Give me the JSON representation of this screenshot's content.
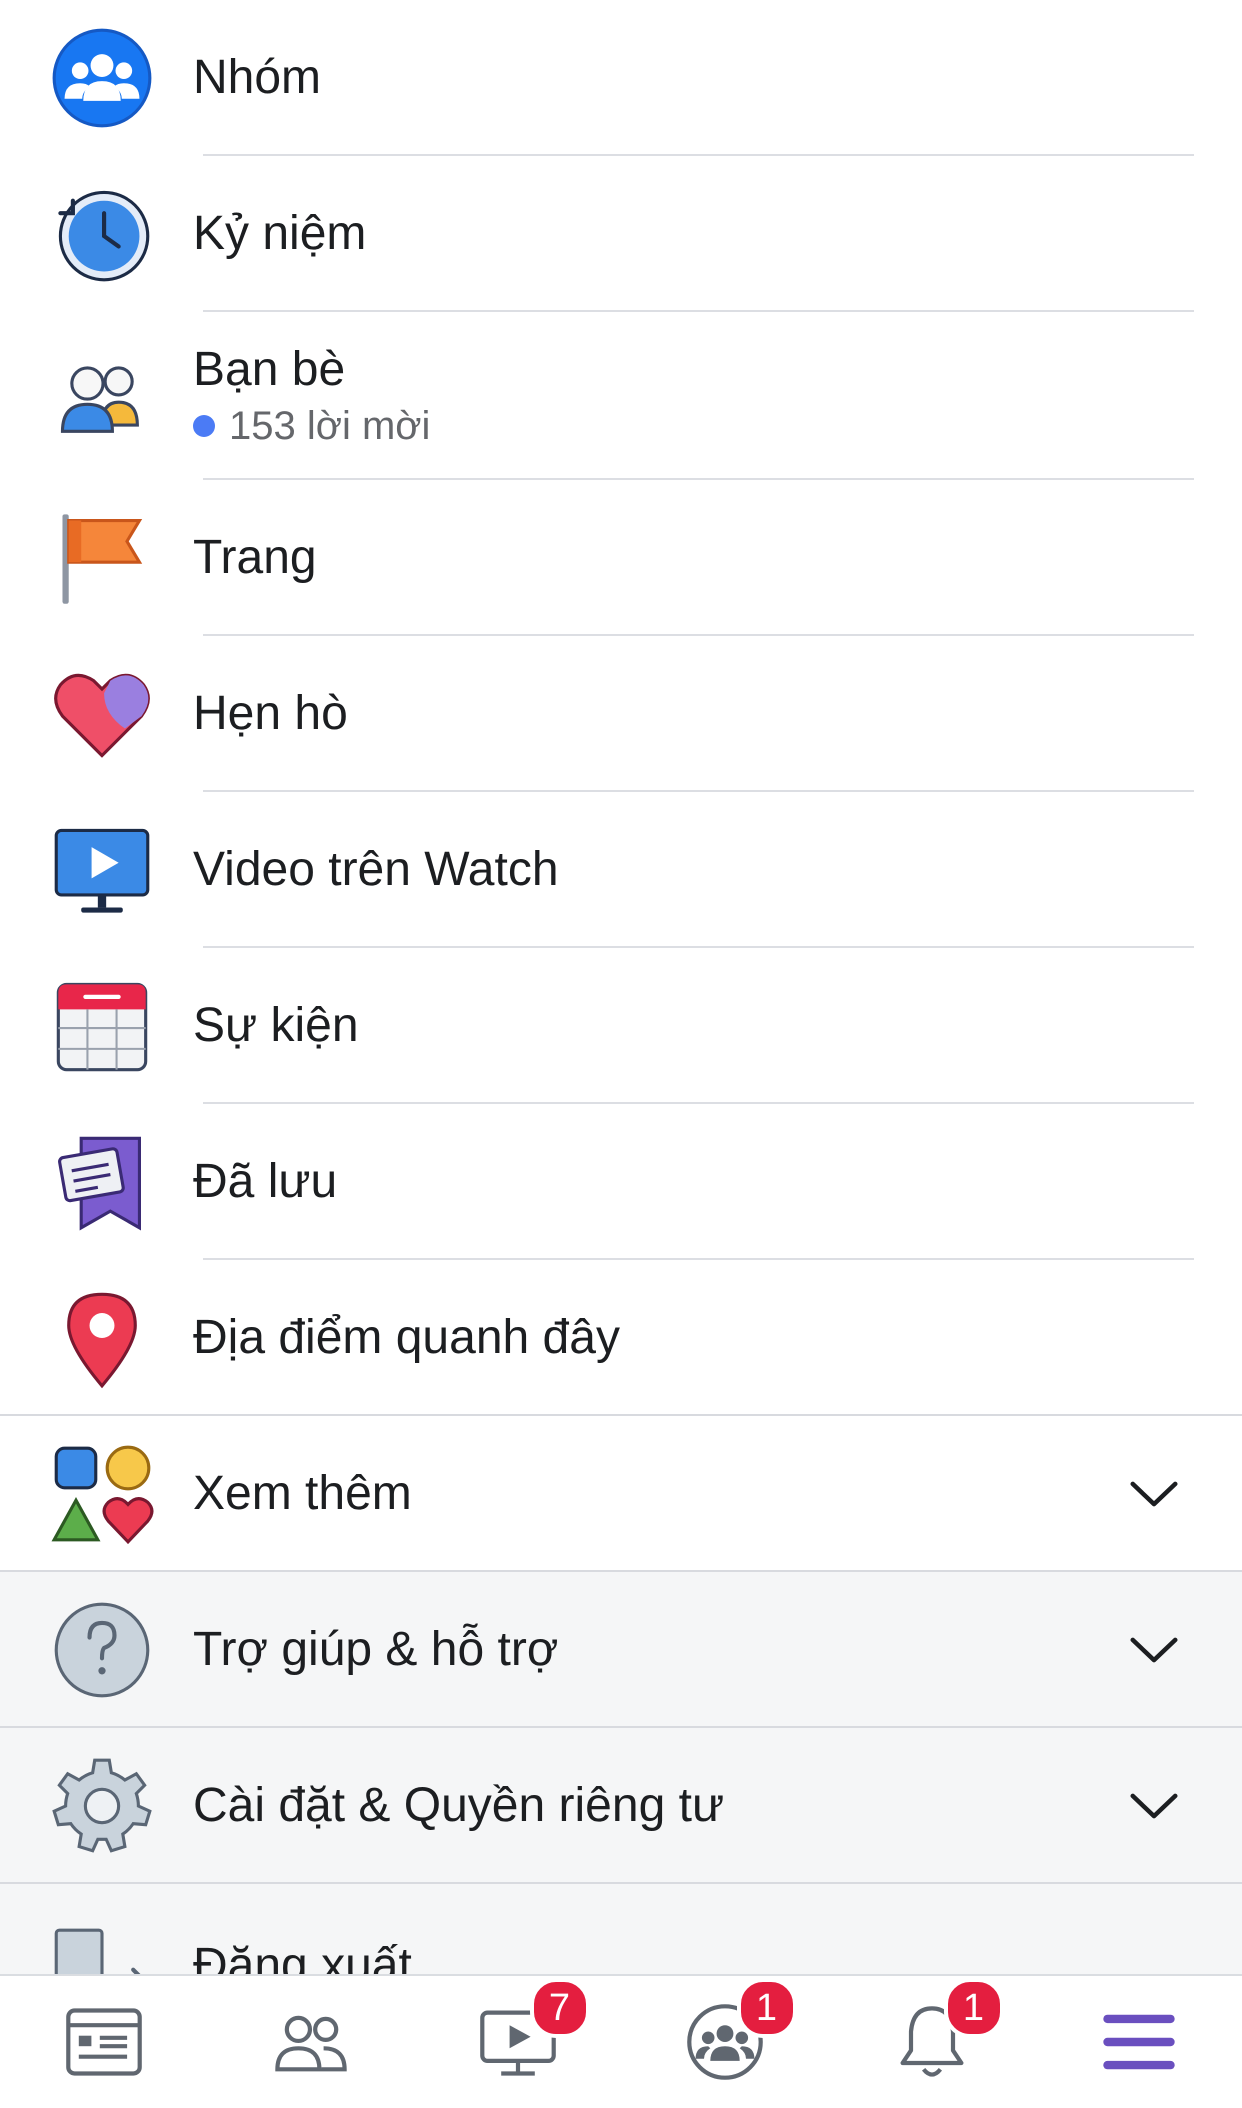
{
  "menu": {
    "items": [
      {
        "label": "Nhóm"
      },
      {
        "label": "Kỷ niệm"
      },
      {
        "label": "Bạn bè",
        "sub": "153 lời mời"
      },
      {
        "label": "Trang"
      },
      {
        "label": "Hẹn hò"
      },
      {
        "label": "Video trên Watch"
      },
      {
        "label": "Sự kiện"
      },
      {
        "label": "Đã lưu"
      },
      {
        "label": "Địa điểm quanh đây"
      },
      {
        "label": "Xem thêm"
      },
      {
        "label": "Trợ giúp & hỗ trợ"
      },
      {
        "label": "Cài đặt & Quyền riêng tư"
      },
      {
        "label": "Đăng xuất"
      }
    ]
  },
  "tabbar": {
    "watch_badge": "7",
    "groups_badge": "1",
    "notifications_badge": "1"
  },
  "colors": {
    "accent": "#1877f2",
    "badge": "#e41e3f",
    "menu_active": "#6a4fbf"
  }
}
